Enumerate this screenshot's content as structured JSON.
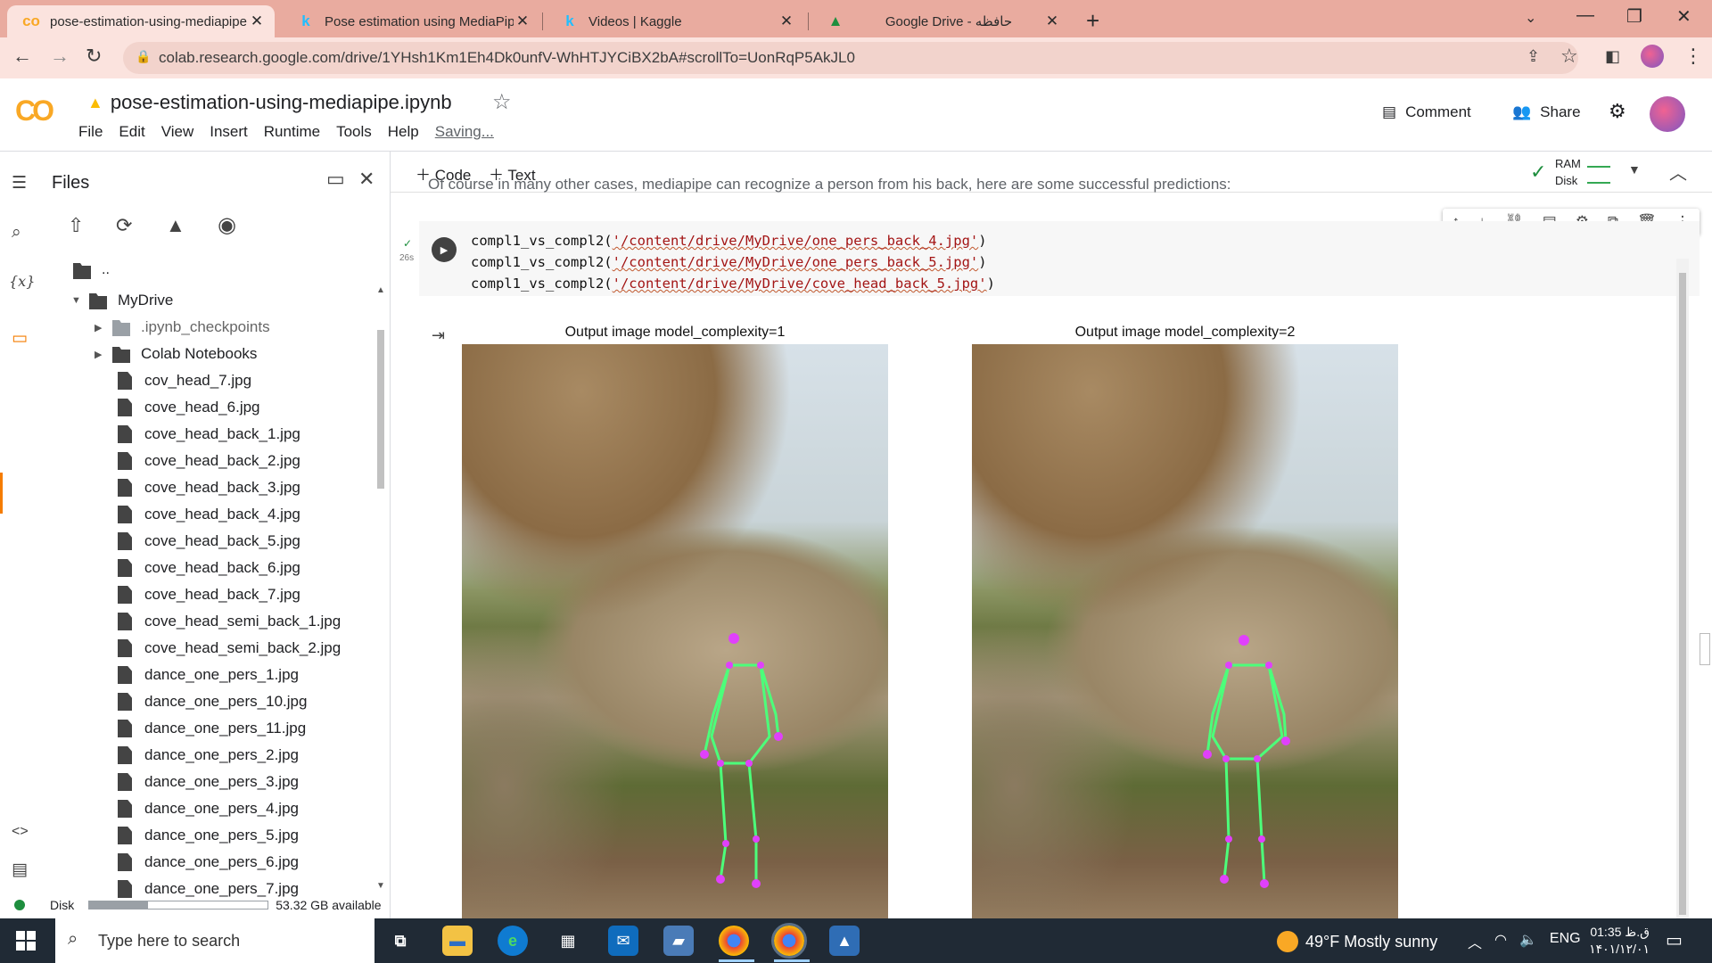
{
  "browser": {
    "tabs": [
      {
        "title": "pose-estimation-using-mediapipe",
        "favicon": "CO",
        "active": true
      },
      {
        "title": "Pose estimation using MediaPipe",
        "favicon": "k",
        "active": false
      },
      {
        "title": "Videos | Kaggle",
        "favicon": "k",
        "active": false
      },
      {
        "title": "Google Drive - حافظه",
        "favicon": "drive-icon",
        "active": false
      }
    ],
    "url": "colab.research.google.com/drive/1YHsh1Km1Eh4Dk0unfV-WhHTJYCiBX2bA#scrollTo=UonRqP5AkJL0"
  },
  "colab": {
    "notebook_title": "pose-estimation-using-mediapipe.ipynb",
    "menu": [
      "File",
      "Edit",
      "View",
      "Insert",
      "Runtime",
      "Tools",
      "Help"
    ],
    "saving_label": "Saving...",
    "comment_label": "Comment",
    "share_label": "Share"
  },
  "files": {
    "title": "Files",
    "parent_label": "..",
    "tree": [
      {
        "label": "MyDrive",
        "type": "folder",
        "level": 0,
        "caret": "open"
      },
      {
        "label": ".ipynb_checkpoints",
        "type": "folder-grey",
        "level": 1,
        "caret": "closed"
      },
      {
        "label": "Colab Notebooks",
        "type": "folder",
        "level": 1,
        "caret": "closed"
      },
      {
        "label": "cov_head_7.jpg",
        "type": "file",
        "level": 1
      },
      {
        "label": "cove_head_6.jpg",
        "type": "file",
        "level": 1
      },
      {
        "label": "cove_head_back_1.jpg",
        "type": "file",
        "level": 1
      },
      {
        "label": "cove_head_back_2.jpg",
        "type": "file",
        "level": 1
      },
      {
        "label": "cove_head_back_3.jpg",
        "type": "file",
        "level": 1
      },
      {
        "label": "cove_head_back_4.jpg",
        "type": "file",
        "level": 1
      },
      {
        "label": "cove_head_back_5.jpg",
        "type": "file",
        "level": 1
      },
      {
        "label": "cove_head_back_6.jpg",
        "type": "file",
        "level": 1
      },
      {
        "label": "cove_head_back_7.jpg",
        "type": "file",
        "level": 1
      },
      {
        "label": "cove_head_semi_back_1.jpg",
        "type": "file",
        "level": 1
      },
      {
        "label": "cove_head_semi_back_2.jpg",
        "type": "file",
        "level": 1
      },
      {
        "label": "dance_one_pers_1.jpg",
        "type": "file",
        "level": 1
      },
      {
        "label": "dance_one_pers_10.jpg",
        "type": "file",
        "level": 1
      },
      {
        "label": "dance_one_pers_11.jpg",
        "type": "file",
        "level": 1
      },
      {
        "label": "dance_one_pers_2.jpg",
        "type": "file",
        "level": 1
      },
      {
        "label": "dance_one_pers_3.jpg",
        "type": "file",
        "level": 1
      },
      {
        "label": "dance_one_pers_4.jpg",
        "type": "file",
        "level": 1
      },
      {
        "label": "dance_one_pers_5.jpg",
        "type": "file",
        "level": 1
      },
      {
        "label": "dance_one_pers_6.jpg",
        "type": "file",
        "level": 1
      },
      {
        "label": "dance_one_pers_7.jpg",
        "type": "file",
        "level": 1
      }
    ],
    "disk_label": "Disk",
    "disk_available": "53.32 GB available",
    "disk_used_fraction": 0.33
  },
  "notebook": {
    "add_code_label": "Code",
    "add_text_label": "Text",
    "ram_label": "RAM",
    "disk_label": "Disk",
    "cut_text": "Of course in many other cases, mediapipe can recognize a person from his back, here are some successful predictions:",
    "exec_time": "26s",
    "code_lines": [
      {
        "fn": "compl1_vs_compl2(",
        "path": "'/content/drive/MyDrive/one_pers_back_4.jpg'",
        "end": ")"
      },
      {
        "fn": "compl1_vs_compl2(",
        "path": "'/content/drive/MyDrive/one_pers_back_5.jpg'",
        "end": ")"
      },
      {
        "fn": "compl1_vs_compl2(",
        "path": "'/content/drive/MyDrive/cove_head_back_5.jpg'",
        "end": ")"
      }
    ],
    "outputs": [
      {
        "title": "Output image model_complexity=1"
      },
      {
        "title": "Output image model_complexity=2"
      }
    ]
  },
  "taskbar": {
    "search_placeholder": "Type here to search",
    "weather": "49°F  Mostly sunny",
    "language": "ENG",
    "time": "01:35 ق.ظ",
    "date": "۱۴۰۱/۱۲/۰۱"
  },
  "colors": {
    "tab_strip": "#e9ab9f",
    "toolbar": "#fbe3de",
    "colab_orange": "#f9a825",
    "skeleton_green": "#4cff7a",
    "skeleton_magenta": "#e040fb"
  }
}
